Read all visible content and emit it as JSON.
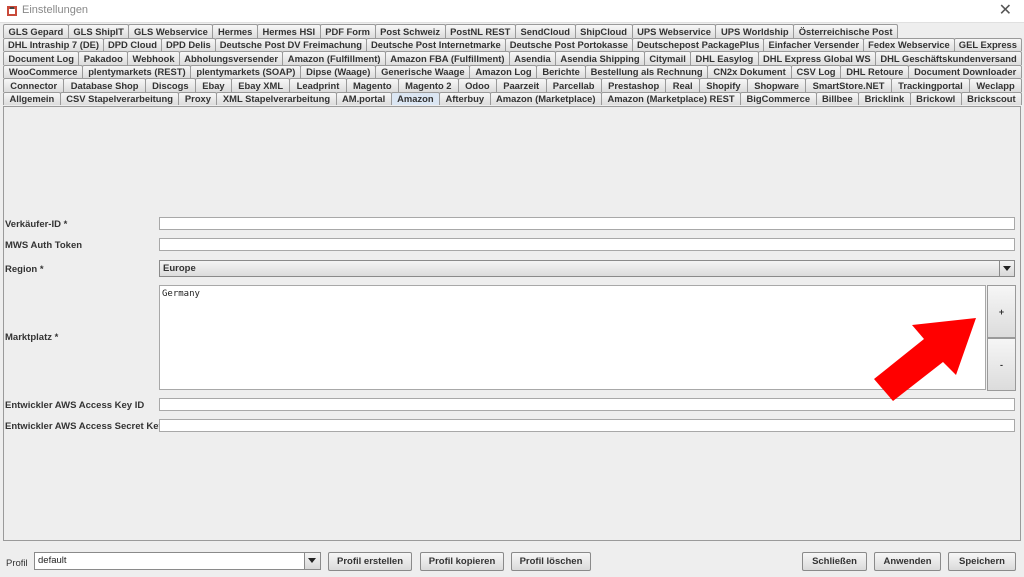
{
  "window": {
    "title": "Einstellungen",
    "close_glyph": "✕"
  },
  "tab_rows": [
    [
      "GLS Gepard",
      "GLS ShipIT",
      "GLS Webservice",
      "Hermes",
      "Hermes HSI",
      "PDF Form",
      "Post Schweiz",
      "PostNL REST",
      "SendCloud",
      "ShipCloud",
      "UPS Webservice",
      "UPS Worldship",
      "Österreichische Post"
    ],
    [
      "DHL Intraship 7 (DE)",
      "DPD Cloud",
      "DPD Delis",
      "Deutsche Post DV Freimachung",
      "Deutsche Post Internetmarke",
      "Deutsche Post Portokasse",
      "Deutschepost PackagePlus",
      "Einfacher Versender",
      "Fedex Webservice",
      "GEL Express"
    ],
    [
      "Document Log",
      "Pakadoo",
      "Webhook",
      "Abholungsversender",
      "Amazon (Fulfillment)",
      "Amazon FBA (Fulfillment)",
      "Asendia",
      "Asendia Shipping",
      "Citymail",
      "DHL Easylog",
      "DHL Express Global WS",
      "DHL Geschäftskundenversand"
    ],
    [
      "WooCommerce",
      "plentymarkets (REST)",
      "plentymarkets (SOAP)",
      "Dipse (Waage)",
      "Generische Waage",
      "Amazon Log",
      "Berichte",
      "Bestellung als Rechnung",
      "CN2x Dokument",
      "CSV Log",
      "DHL Retoure",
      "Document Downloader"
    ],
    [
      "Connector",
      "Database Shop",
      "Discogs",
      "Ebay",
      "Ebay XML",
      "Leadprint",
      "Magento",
      "Magento 2",
      "Odoo",
      "Paarzeit",
      "Parcellab",
      "Prestashop",
      "Real",
      "Shopify",
      "Shopware",
      "SmartStore.NET",
      "Trackingportal",
      "Weclapp"
    ],
    [
      "Allgemein",
      "CSV Stapelverarbeitung",
      "Proxy",
      "XML Stapelverarbeitung",
      "AM.portal",
      "Amazon",
      "Afterbuy",
      "Amazon (Marketplace)",
      "Amazon (Marketplace) REST",
      "BigCommerce",
      "Billbee",
      "Bricklink",
      "Brickowl",
      "Brickscout"
    ]
  ],
  "active_tab": "Amazon",
  "form": {
    "seller_id_label": "Verkäufer-ID *",
    "seller_id_value": "",
    "mws_token_label": "MWS Auth Token",
    "mws_token_value": "",
    "region_label": "Region *",
    "region_value": "Europe",
    "marketplace_label": "Marktplatz *",
    "marketplace_items": [
      "Germany"
    ],
    "add_label": "+",
    "remove_label": "-",
    "access_key_label": "Entwickler AWS Access Key ID",
    "access_key_value": "",
    "secret_key_label": "Entwickler AWS Access Secret Key",
    "secret_key_value": ""
  },
  "bottom": {
    "profile_label": "Profil",
    "profile_value": "default",
    "create_label": "Profil erstellen",
    "copy_label": "Profil kopieren",
    "delete_label": "Profil löschen",
    "close_label": "Schließen",
    "apply_label": "Anwenden",
    "save_label": "Speichern"
  },
  "colors": {
    "annotation_arrow": "#ff0000",
    "active_tab": "#dbe6f3"
  }
}
